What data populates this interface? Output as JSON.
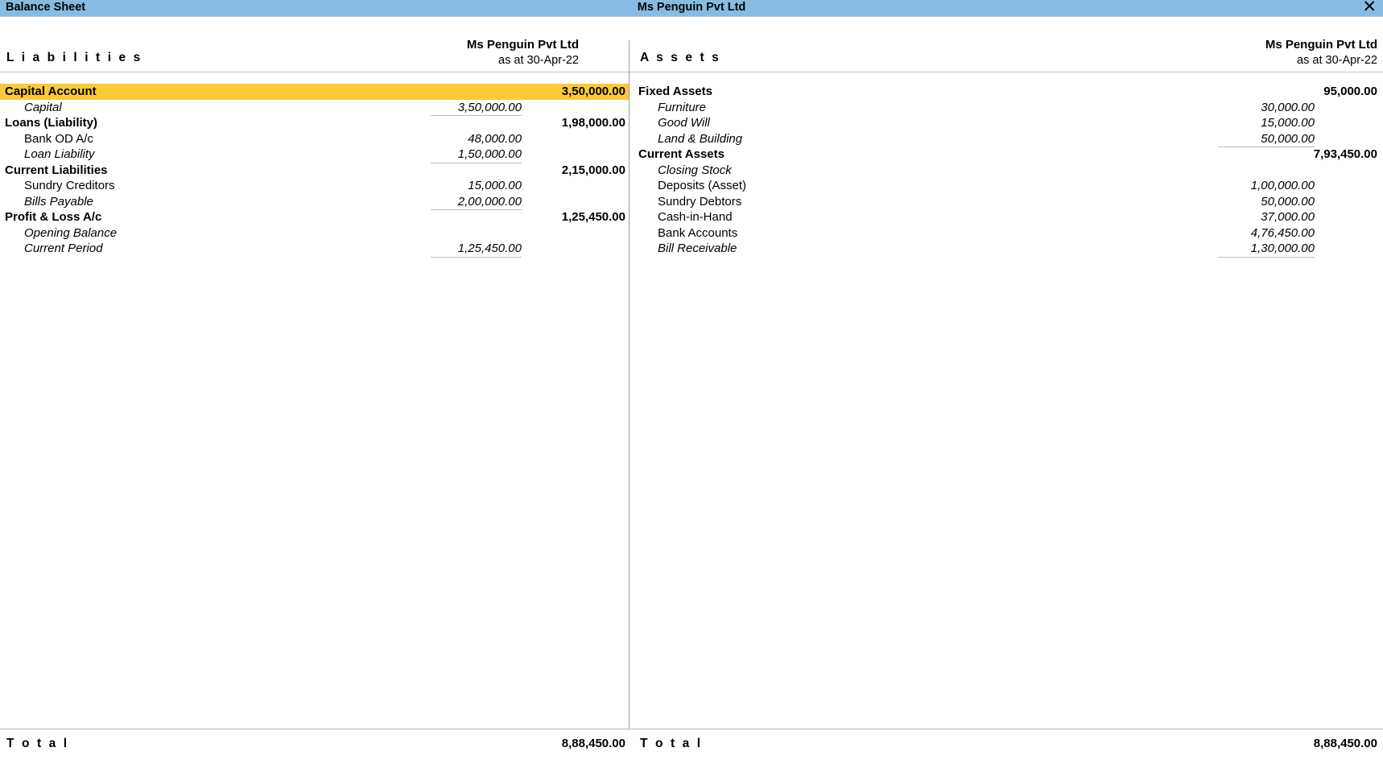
{
  "window": {
    "title": "Balance Sheet",
    "center_title": "Ms Penguin Pvt Ltd",
    "close_icon": "✕",
    "titlebar_color": "#86bce3",
    "highlight_color": "#fcca37"
  },
  "liabilities": {
    "side_title": "L i a b i l i t i e s",
    "entity": "Ms Penguin Pvt Ltd",
    "as_at": "as at 30-Apr-22",
    "total_label": "T o t a l",
    "total_value": "8,88,450.00",
    "groups": [
      {
        "name": "Capital Account",
        "amount": "3,50,000.00",
        "highlight": true,
        "items": [
          {
            "label": "Capital",
            "amount": "3,50,000.00",
            "italic": true
          }
        ]
      },
      {
        "name": "Loans (Liability)",
        "amount": "1,98,000.00",
        "highlight": false,
        "items": [
          {
            "label": "Bank OD A/c",
            "amount": "48,000.00",
            "italic": false
          },
          {
            "label": "Loan Liability",
            "amount": "1,50,000.00",
            "italic": true
          }
        ]
      },
      {
        "name": "Current Liabilities",
        "amount": "2,15,000.00",
        "highlight": false,
        "items": [
          {
            "label": "Sundry Creditors",
            "amount": "15,000.00",
            "italic": false
          },
          {
            "label": "Bills Payable",
            "amount": "2,00,000.00",
            "italic": true
          }
        ]
      },
      {
        "name": "Profit & Loss A/c",
        "amount": "1,25,450.00",
        "highlight": false,
        "items": [
          {
            "label": "Opening Balance",
            "amount": "",
            "italic": true
          },
          {
            "label": "Current Period",
            "amount": "1,25,450.00",
            "italic": true
          }
        ]
      }
    ]
  },
  "assets": {
    "side_title": "A s s e t s",
    "entity": "Ms Penguin Pvt Ltd",
    "as_at": "as at 30-Apr-22",
    "total_label": "T o t a l",
    "total_value": "8,88,450.00",
    "groups": [
      {
        "name": "Fixed Assets",
        "amount": "95,000.00",
        "highlight": false,
        "items": [
          {
            "label": "Furniture",
            "amount": "30,000.00",
            "italic": true
          },
          {
            "label": "Good Will",
            "amount": "15,000.00",
            "italic": true
          },
          {
            "label": "Land & Building",
            "amount": "50,000.00",
            "italic": true
          }
        ]
      },
      {
        "name": "Current Assets",
        "amount": "7,93,450.00",
        "highlight": false,
        "items": [
          {
            "label": "Closing Stock",
            "amount": "",
            "italic": true
          },
          {
            "label": "Deposits (Asset)",
            "amount": "1,00,000.00",
            "italic": false
          },
          {
            "label": "Sundry Debtors",
            "amount": "50,000.00",
            "italic": false
          },
          {
            "label": "Cash-in-Hand",
            "amount": "37,000.00",
            "italic": false
          },
          {
            "label": "Bank Accounts",
            "amount": "4,76,450.00",
            "italic": false
          },
          {
            "label": "Bill Receivable",
            "amount": "1,30,000.00",
            "italic": true
          }
        ]
      }
    ]
  }
}
